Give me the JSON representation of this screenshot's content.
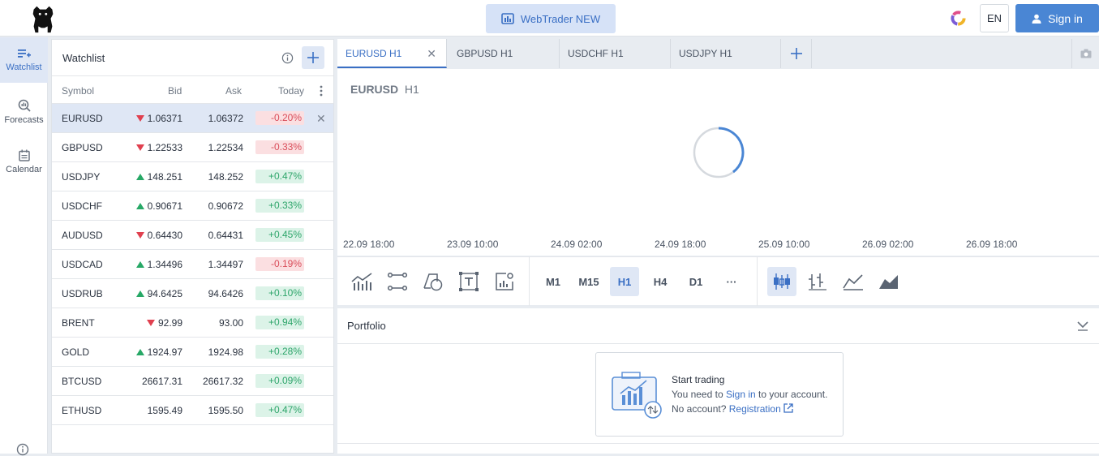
{
  "header": {
    "webtrader_label": "WebTrader NEW",
    "lang": "EN",
    "signin_label": "Sign in"
  },
  "nav": {
    "items": [
      {
        "label": "Watchlist",
        "icon": "watchlist-add-icon"
      },
      {
        "label": "Forecasts",
        "icon": "forecasts-icon"
      },
      {
        "label": "Calendar",
        "icon": "calendar-icon"
      }
    ]
  },
  "watchlist": {
    "title": "Watchlist",
    "columns": {
      "symbol": "Symbol",
      "bid": "Bid",
      "ask": "Ask",
      "today": "Today"
    },
    "rows": [
      {
        "symbol": "EURUSD",
        "dir": "down",
        "bid": "1.06371",
        "ask": "1.06372",
        "today": "-0.20%"
      },
      {
        "symbol": "GBPUSD",
        "dir": "down",
        "bid": "1.22533",
        "ask": "1.22534",
        "today": "-0.33%"
      },
      {
        "symbol": "USDJPY",
        "dir": "up",
        "bid": "148.251",
        "ask": "148.252",
        "today": "+0.47%"
      },
      {
        "symbol": "USDCHF",
        "dir": "up",
        "bid": "0.90671",
        "ask": "0.90672",
        "today": "+0.33%"
      },
      {
        "symbol": "AUDUSD",
        "dir": "down",
        "bid": "0.64430",
        "ask": "0.64431",
        "today": "+0.45%"
      },
      {
        "symbol": "USDCAD",
        "dir": "up",
        "bid": "1.34496",
        "ask": "1.34497",
        "today": "-0.19%"
      },
      {
        "symbol": "USDRUB",
        "dir": "up",
        "bid": "94.6425",
        "ask": "94.6426",
        "today": "+0.10%"
      },
      {
        "symbol": "BRENT",
        "dir": "down",
        "bid": "92.99",
        "ask": "93.00",
        "today": "+0.94%"
      },
      {
        "symbol": "GOLD",
        "dir": "up",
        "bid": "1924.97",
        "ask": "1924.98",
        "today": "+0.28%"
      },
      {
        "symbol": "BTCUSD",
        "dir": "none",
        "bid": "26617.31",
        "ask": "26617.32",
        "today": "+0.09%"
      },
      {
        "symbol": "ETHUSD",
        "dir": "none",
        "bid": "1595.49",
        "ask": "1595.50",
        "today": "+0.47%"
      }
    ]
  },
  "tabs": [
    {
      "label": "EURUSD H1",
      "active": true
    },
    {
      "label": "GBPUSD H1",
      "active": false
    },
    {
      "label": "USDCHF H1",
      "active": false
    },
    {
      "label": "USDJPY H1",
      "active": false
    }
  ],
  "chart": {
    "symbol": "EURUSD",
    "timeframe": "H1",
    "x_ticks": [
      "22.09 18:00",
      "23.09 10:00",
      "24.09 02:00",
      "24.09 18:00",
      "25.09 10:00",
      "26.09 02:00",
      "26.09 18:00"
    ]
  },
  "toolbar": {
    "timeframes": [
      "M1",
      "M15",
      "H1",
      "H4",
      "D1",
      "···"
    ],
    "active_timeframe": "H1"
  },
  "portfolio": {
    "title": "Portfolio",
    "start_title": "Start trading",
    "need_prefix": "You need to",
    "signin_link": "Sign in",
    "need_suffix": "to your account.",
    "no_account": "No account?",
    "registration_link": "Registration"
  },
  "colors": {
    "accent": "#3a6fc4",
    "up": "#27a866",
    "down": "#e0404f"
  }
}
